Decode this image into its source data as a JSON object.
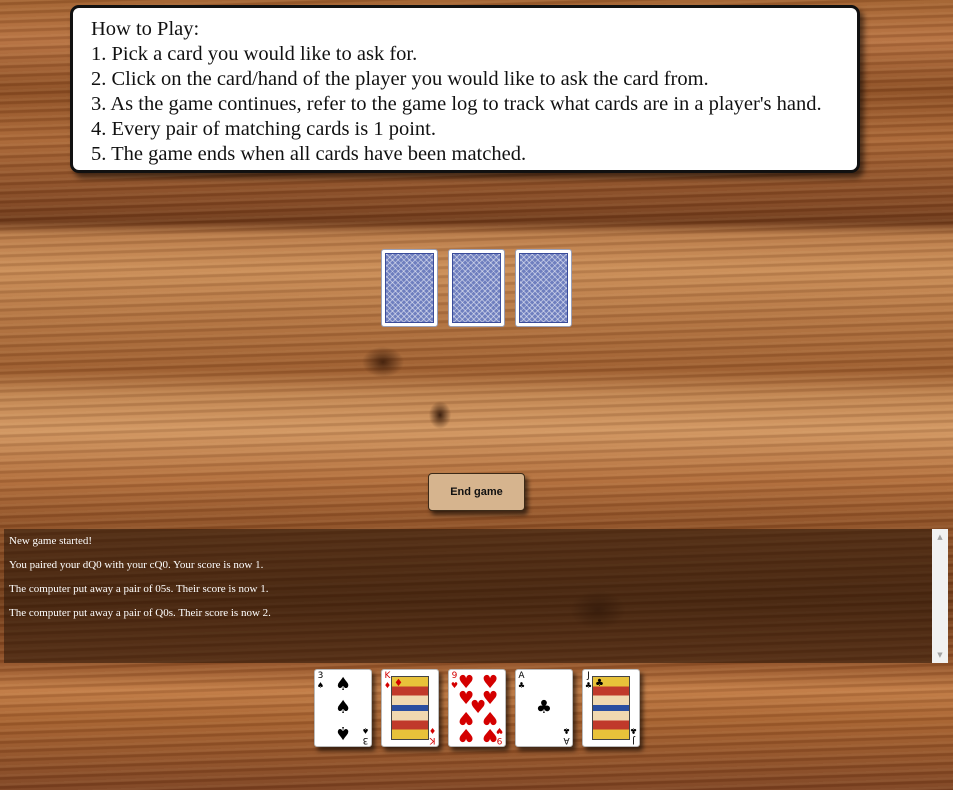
{
  "instructions": {
    "title": "How to Play:",
    "steps": [
      "1. Pick a card you would like to ask for.",
      "2. Click on the card/hand of the player you would like to ask the card from.",
      "3. As the game continues, refer to the game log to track what cards are in a player's hand.",
      "4. Every pair of matching cards is 1 point.",
      "5. The game ends when all cards have been matched."
    ]
  },
  "opponent": {
    "card_count": 3
  },
  "controls": {
    "end_game_label": "End game"
  },
  "game_log": {
    "lines": [
      "New game started!",
      "You paired your dQ0 with your cQ0. Your score is now 1.",
      "The computer put away a pair of 05s. Their score is now 1.",
      "The computer put away a pair of Q0s. Their score is now 2."
    ],
    "scroll_up_icon": "▲",
    "scroll_down_icon": "▼"
  },
  "player_hand": [
    {
      "rank": "3",
      "suit": "♠",
      "suit_name": "spades",
      "color": "black"
    },
    {
      "rank": "K",
      "suit": "♦",
      "suit_name": "diamonds",
      "color": "red"
    },
    {
      "rank": "9",
      "suit": "♥",
      "suit_name": "hearts",
      "color": "red"
    },
    {
      "rank": "A",
      "suit": "♣",
      "suit_name": "clubs",
      "color": "black"
    },
    {
      "rank": "J",
      "suit": "♣",
      "suit_name": "clubs",
      "color": "black"
    }
  ]
}
